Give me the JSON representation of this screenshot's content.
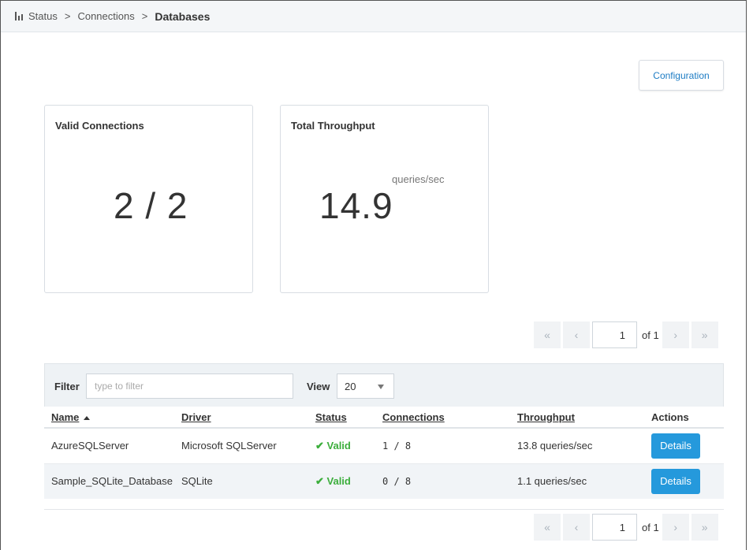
{
  "breadcrumb": {
    "items": [
      "Status",
      "Connections"
    ],
    "separator": ">",
    "current": "Databases"
  },
  "config_button": "Configuration",
  "cards": {
    "valid_connections": {
      "title": "Valid Connections",
      "value": "2 / 2"
    },
    "total_throughput": {
      "title": "Total Throughput",
      "value": "14.9",
      "unit": "queries/sec"
    }
  },
  "pager": {
    "first": "«",
    "prev": "‹",
    "page": "1",
    "of": "of 1",
    "next": "›",
    "last": "»"
  },
  "filter": {
    "label": "Filter",
    "placeholder": "type to filter",
    "view_label": "View",
    "view_value": "20"
  },
  "table": {
    "columns": [
      "Name",
      "Driver",
      "Status",
      "Connections",
      "Throughput",
      "Actions"
    ],
    "rows": [
      {
        "name": "AzureSQLServer",
        "driver": "Microsoft SQLServer",
        "status": "Valid",
        "connections": "1 / 8",
        "throughput": "13.8 queries/sec",
        "action": "Details"
      },
      {
        "name": "Sample_SQLite_Database",
        "driver": "SQLite",
        "status": "Valid",
        "connections": "0 / 8",
        "throughput": "1.1 queries/sec",
        "action": "Details"
      }
    ]
  },
  "colors": {
    "accent": "#2599dc",
    "link": "#1d7cc4",
    "valid": "#3cae3c"
  },
  "icons": {
    "breadcrumb": "bar-chart-icon",
    "sort": "sort-ascending-icon",
    "status_ok": "check-icon"
  }
}
